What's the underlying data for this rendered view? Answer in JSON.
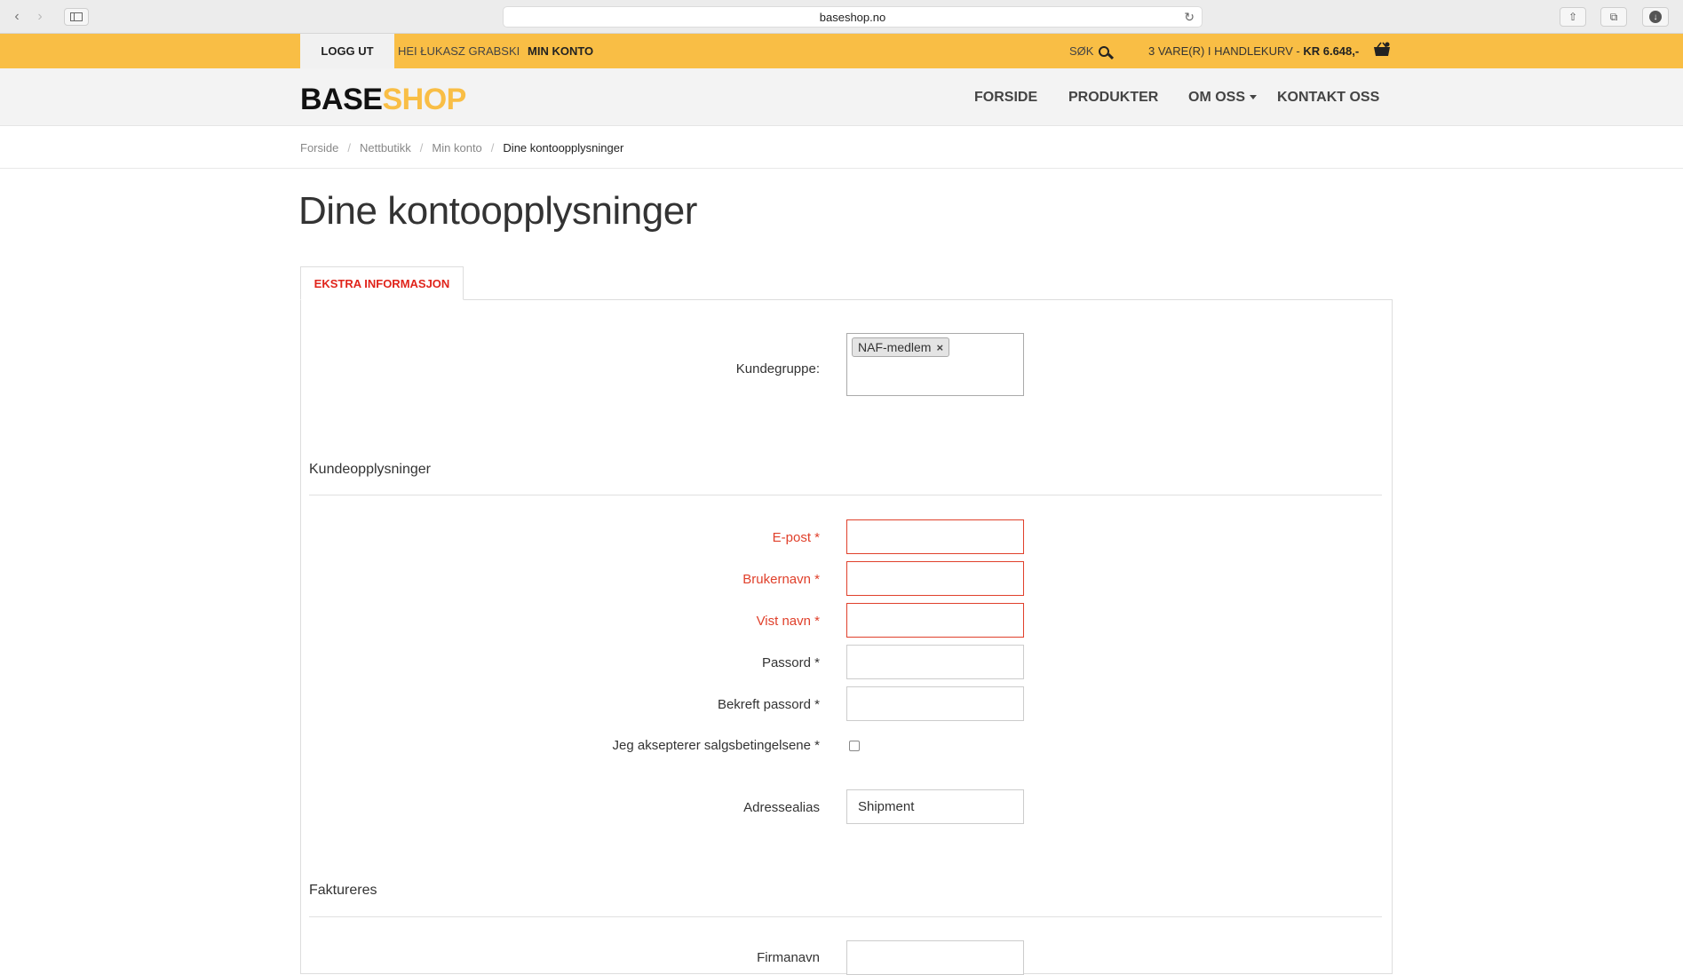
{
  "browser": {
    "url": "baseshop.no"
  },
  "topbar": {
    "logout": "LOGG UT",
    "greeting": "HEI ŁUKASZ GRABSKI",
    "my_account": "MIN KONTO",
    "search": "SØK",
    "cart_prefix": "3 VARE(R) I HANDLEKURV - ",
    "cart_total": "KR 6.648,-",
    "accent_color": "#f9be45"
  },
  "header": {
    "logo_base": "BASE",
    "logo_shop": "SHOP",
    "nav": [
      "FORSIDE",
      "PRODUKTER",
      "OM OSS",
      "KONTAKT OSS"
    ]
  },
  "breadcrumb": [
    "Forside",
    "Nettbutikk",
    "Min konto",
    "Dine kontoopplysninger"
  ],
  "page": {
    "title": "Dine kontoopplysninger",
    "tab": "EKSTRA INFORMASJON"
  },
  "form": {
    "customer_group": {
      "label": "Kundegruppe:",
      "selected": "NAF-medlem",
      "remove_symbol": "×"
    },
    "section_customer": "Kundeopplysninger",
    "email_label": "E-post *",
    "username_label": "Brukernavn *",
    "display_name_label": "Vist navn *",
    "password_label": "Passord *",
    "confirm_password_label": "Bekreft passord *",
    "terms_label": "Jeg aksepterer salgsbetingelsene *",
    "address_alias_label": "Adressealias",
    "address_alias_value": "Shipment",
    "section_billing": "Faktureres",
    "company_label": "Firmanavn"
  }
}
